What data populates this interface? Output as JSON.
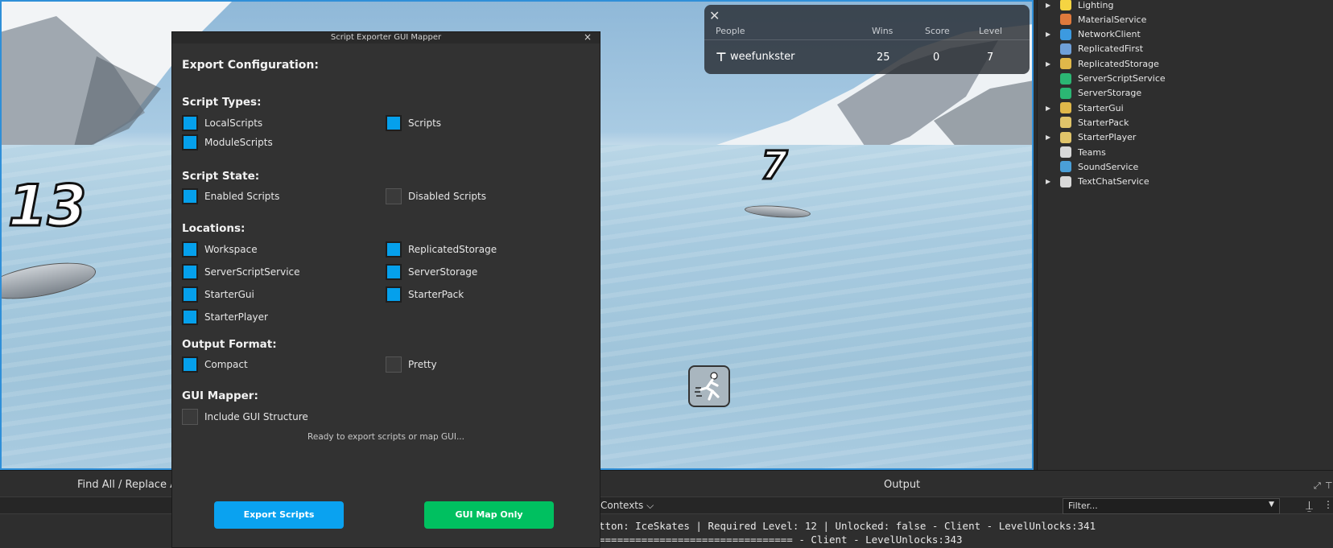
{
  "viewport": {
    "numbers": [
      "13",
      "7"
    ]
  },
  "leaderboard": {
    "headers": {
      "people": "People",
      "wins": "Wins",
      "score": "Score",
      "level": "Level"
    },
    "rows": [
      {
        "name": "weefunkster",
        "wins": "25",
        "score": "0",
        "level": "7"
      }
    ]
  },
  "explorer": {
    "items": [
      {
        "label": "Lighting",
        "expand": true,
        "icon_color": "#f5d442",
        "icon": "lightbulb-icon"
      },
      {
        "label": "MaterialService",
        "expand": false,
        "icon_color": "#e07a3c",
        "icon": "material-icon"
      },
      {
        "label": "NetworkClient",
        "expand": true,
        "icon_color": "#3c9ae0",
        "icon": "network-icon"
      },
      {
        "label": "ReplicatedFirst",
        "expand": false,
        "icon_color": "#6fa0d8",
        "icon": "replicated-icon"
      },
      {
        "label": "ReplicatedStorage",
        "expand": true,
        "icon_color": "#e0b84a",
        "icon": "folder-icon"
      },
      {
        "label": "ServerScriptService",
        "expand": false,
        "icon_color": "#2bb673",
        "icon": "server-script-icon"
      },
      {
        "label": "ServerStorage",
        "expand": false,
        "icon_color": "#2bb673",
        "icon": "server-storage-icon"
      },
      {
        "label": "StarterGui",
        "expand": true,
        "icon_color": "#e0b84a",
        "icon": "folder-icon"
      },
      {
        "label": "StarterPack",
        "expand": false,
        "icon_color": "#e0c46a",
        "icon": "folder-icon"
      },
      {
        "label": "StarterPlayer",
        "expand": true,
        "icon_color": "#e0c46a",
        "icon": "folder-icon"
      },
      {
        "label": "Teams",
        "expand": false,
        "icon_color": "#d8d8d8",
        "icon": "teams-icon"
      },
      {
        "label": "SoundService",
        "expand": false,
        "icon_color": "#4a9fd8",
        "icon": "sound-icon"
      },
      {
        "label": "TextChatService",
        "expand": true,
        "icon_color": "#d8d8d8",
        "icon": "chat-icon"
      }
    ]
  },
  "bottom": {
    "find_title": "Find All / Replace All",
    "output_title": "Output",
    "contexts": "Contexts",
    "filter_placeholder": "Filter...",
    "log_lines": [
      "tton: IceSkates | Required Level: 12 | Unlocked: false  -  Client - LevelUnlocks:341",
      "================================  -  Client - LevelUnlocks:343"
    ]
  },
  "dialog": {
    "title": "Script Exporter  GUI Mapper",
    "close": "×",
    "heading": "Export Configuration:",
    "sections": {
      "script_types": "Script Types:",
      "script_state": "Script State:",
      "locations": "Locations:",
      "output_format": "Output Format:",
      "gui_mapper": "GUI Mapper:"
    },
    "options": {
      "local_scripts": {
        "label": "LocalScripts",
        "checked": true
      },
      "scripts": {
        "label": "Scripts",
        "checked": true
      },
      "module_scripts": {
        "label": "ModuleScripts",
        "checked": true
      },
      "enabled_scripts": {
        "label": "Enabled Scripts",
        "checked": true
      },
      "disabled_scripts": {
        "label": "Disabled Scripts",
        "checked": false
      },
      "workspace": {
        "label": "Workspace",
        "checked": true
      },
      "replicated_storage": {
        "label": "ReplicatedStorage",
        "checked": true
      },
      "server_script_service": {
        "label": "ServerScriptService",
        "checked": true
      },
      "server_storage": {
        "label": "ServerStorage",
        "checked": true
      },
      "starter_gui": {
        "label": "StarterGui",
        "checked": true
      },
      "starter_pack": {
        "label": "StarterPack",
        "checked": true
      },
      "starter_player": {
        "label": "StarterPlayer",
        "checked": true
      },
      "compact": {
        "label": "Compact",
        "checked": true
      },
      "pretty": {
        "label": "Pretty",
        "checked": false
      },
      "include_gui": {
        "label": "Include GUI Structure",
        "checked": false
      }
    },
    "status": "Ready to export scripts or map GUI...",
    "export_button": "Export Scripts",
    "gui_map_button": "GUI Map Only",
    "colors": {
      "export": "#0aa2f0",
      "gui_map": "#00c060",
      "checkbox_on": "#05a0ec"
    }
  }
}
